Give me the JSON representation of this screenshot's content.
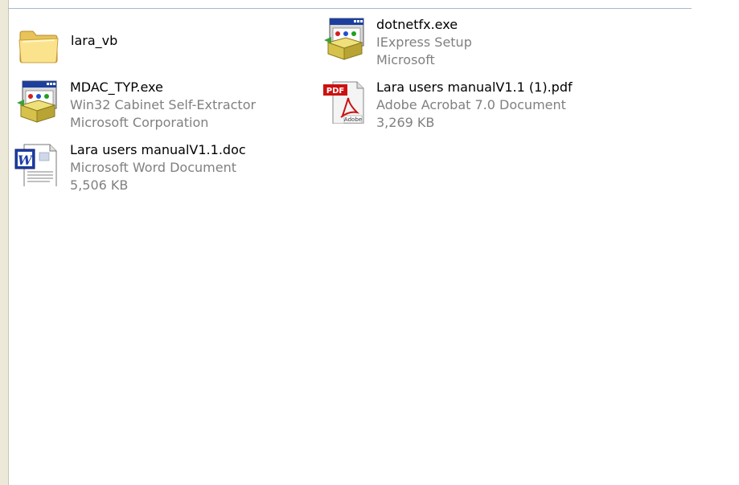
{
  "files": [
    {
      "name": "lara_vb",
      "type": "",
      "detail": "",
      "icon": "folder-icon"
    },
    {
      "name": "dotnetfx.exe",
      "type": "IExpress Setup",
      "detail": "Microsoft",
      "icon": "installer-icon"
    },
    {
      "name": "MDAC_TYP.exe",
      "type": "Win32 Cabinet Self-Extractor",
      "detail": "Microsoft Corporation",
      "icon": "installer-icon"
    },
    {
      "name": "Lara users manualV1.1 (1).pdf",
      "type": "Adobe Acrobat 7.0 Document",
      "detail": "3,269 KB",
      "icon": "pdf-icon"
    },
    {
      "name": "Lara users manualV1.1.doc",
      "type": "Microsoft Word Document",
      "detail": "5,506 KB",
      "icon": "word-document-icon"
    }
  ],
  "pdf_icon_label": "PDF",
  "pdf_icon_sub": "Adobe",
  "word_icon_letter": "W"
}
